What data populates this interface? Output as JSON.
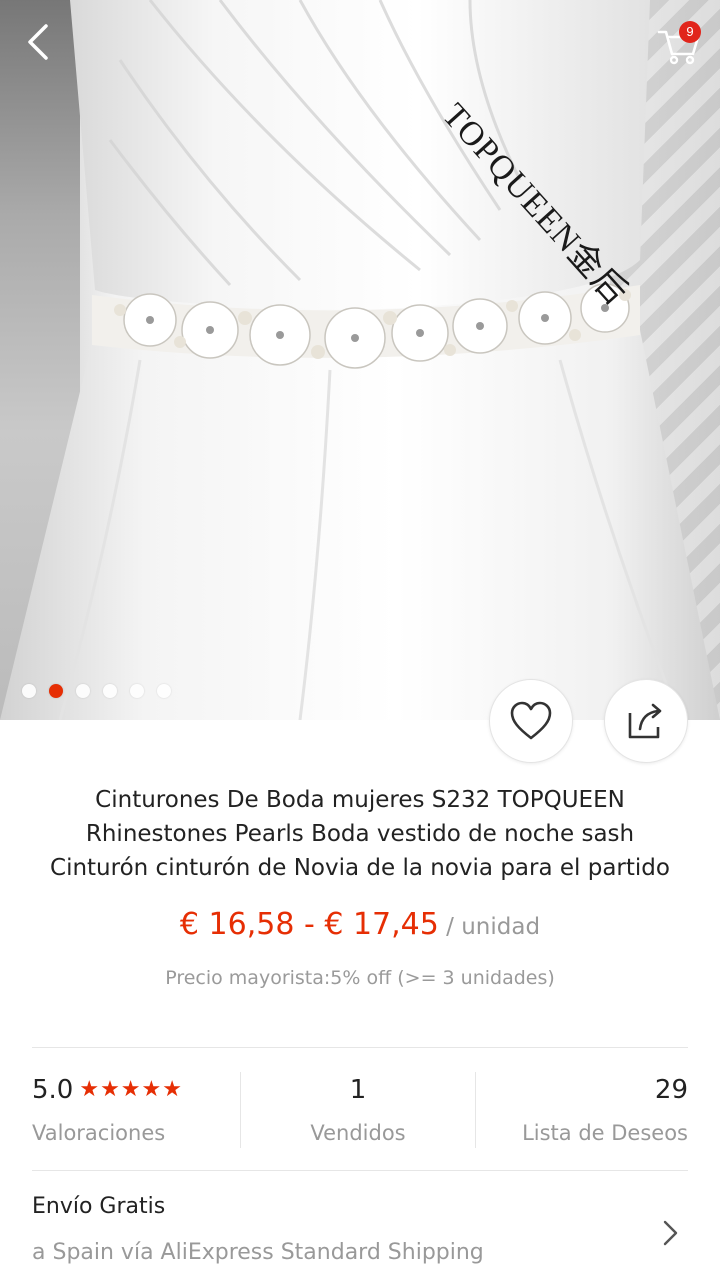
{
  "header": {
    "back_icon": "chevron-left-icon",
    "cart_icon": "cart-icon",
    "cart_count": "9"
  },
  "gallery": {
    "watermark": "TOPQUEEN金后",
    "total_images": 6,
    "active_index": 1
  },
  "actions": {
    "wishlist_icon": "heart-outline-icon",
    "share_icon": "share-icon"
  },
  "product": {
    "title": "Cinturones De Boda mujeres S232 TOPQUEEN Rhinestones Pearls Boda vestido de noche sash Cinturón cinturón de Novia de la novia para el partido",
    "price": "€ 16,58 - € 17,45",
    "unit": " / unidad",
    "wholesale": "Precio mayorista:5% off (>= 3 unidades)"
  },
  "stats": {
    "rating_value": "5.0",
    "rating_stars": "★★★★★",
    "rating_label": "Valoraciones",
    "sold_value": "1",
    "sold_label": "Vendidos",
    "wishlist_value": "29",
    "wishlist_label": "Lista de Deseos"
  },
  "shipping": {
    "title": "Envío Gratis",
    "detail": "a Spain vía AliExpress Standard Shipping"
  },
  "colors": {
    "accent": "#e62e04",
    "badge": "#e1251b",
    "muted_text": "#999999"
  }
}
